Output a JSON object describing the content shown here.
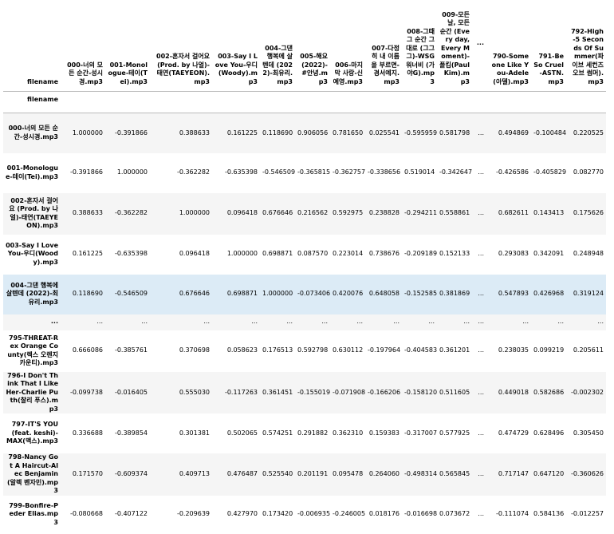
{
  "table": {
    "corner_label": "filename",
    "index_label": "filename",
    "columns": [
      "000-너의 모든 순간-성시경.mp3",
      "001-Monologue-테이(Tei).mp3",
      "002-혼자서 걸어요 (Prod. by 나얼)-태연(TAEYEON).mp3",
      "003-Say I Love You-우디(Woody).mp3",
      "004-그댄 행복에 살텐데 (2022)-최유리.mp3",
      "005-해요 (2022)-#안녕.mp3",
      "006-마지막 사랑-신예영.mp3",
      "007-다정히 내 이름을 부르면-경서예지.mp3",
      "008-그때 그 순간 그대로 (그그그)-WSG워너비 (가야G).mp3",
      "009-모든 날, 모든 순간 (Every day, Every Moment)-폴킴(Paul Kim).mp3",
      "...",
      "790-Someone Like You-Adele(아델).mp3",
      "791-Be So Cruel-ASTN.mp3",
      "792-High-5 Seconds Of Summer(파이브 세컨즈 오브 썸머).mp3"
    ],
    "rows": [
      {
        "label": "000-너의 모든 순간-성시경.mp3",
        "values": [
          "1.000000",
          "-0.391866",
          "0.388633",
          "0.161225",
          "0.118690",
          "0.906056",
          "0.781650",
          "0.025541",
          "-0.595959",
          "0.581798",
          "...",
          "0.494869",
          "-0.100484",
          "0.220525"
        ]
      },
      {
        "label": "001-Monologue-테이(Tei).mp3",
        "values": [
          "-0.391866",
          "1.000000",
          "-0.362282",
          "-0.635398",
          "-0.546509",
          "-0.365815",
          "-0.362757",
          "-0.338656",
          "0.519014",
          "-0.342647",
          "...",
          "-0.426586",
          "-0.405829",
          "0.082770"
        ]
      },
      {
        "label": "002-혼자서 걸어요 (Prod. by 나얼)-태연(TAEYEON).mp3",
        "values": [
          "0.388633",
          "-0.362282",
          "1.000000",
          "0.096418",
          "0.676646",
          "0.216562",
          "0.592975",
          "0.238828",
          "-0.294211",
          "0.558861",
          "...",
          "0.682611",
          "0.143413",
          "0.175626"
        ]
      },
      {
        "label": "003-Say I Love You-우디(Woody).mp3",
        "values": [
          "0.161225",
          "-0.635398",
          "0.096418",
          "1.000000",
          "0.698871",
          "0.087570",
          "0.223014",
          "0.738676",
          "-0.209189",
          "0.152133",
          "...",
          "0.293083",
          "0.342091",
          "0.248948"
        ]
      },
      {
        "label": "004-그댄 행복에 살텐데 (2022)-최유리.mp3",
        "values": [
          "0.118690",
          "-0.546509",
          "0.676646",
          "0.698871",
          "1.000000",
          "-0.073406",
          "0.420076",
          "0.648058",
          "-0.152585",
          "0.381869",
          "...",
          "0.547893",
          "0.426968",
          "0.319124"
        ]
      },
      {
        "label": "...",
        "values": [
          "...",
          "...",
          "...",
          "...",
          "...",
          "...",
          "...",
          "...",
          "...",
          "...",
          "...",
          "...",
          "...",
          "..."
        ]
      },
      {
        "label": "795-THREAT-Rex Orange County(렉스 오렌지 카운티).mp3",
        "values": [
          "0.666086",
          "-0.385761",
          "0.370698",
          "0.058623",
          "0.176513",
          "0.592798",
          "0.630112",
          "-0.197964",
          "-0.404583",
          "0.361201",
          "...",
          "0.238035",
          "0.099219",
          "0.205611"
        ]
      },
      {
        "label": "796-I Don't Think That I Like Her-Charlie Puth(찰리 푸스).mp3",
        "values": [
          "-0.099738",
          "-0.016405",
          "0.555030",
          "-0.117263",
          "0.361451",
          "-0.155019",
          "-0.071908",
          "-0.166206",
          "-0.158120",
          "0.511605",
          "...",
          "0.449018",
          "0.582686",
          "-0.002302"
        ]
      },
      {
        "label": "797-IT'S YOU (feat. keshi)-MAX(맥스).mp3",
        "values": [
          "0.336688",
          "-0.389854",
          "0.301381",
          "0.502065",
          "0.574251",
          "0.291882",
          "0.362310",
          "0.159383",
          "-0.317007",
          "0.577925",
          "...",
          "0.474729",
          "0.628496",
          "0.305450"
        ]
      },
      {
        "label": "798-Nancy Got A Haircut-Alec Benjamin(알렉 벤자민).mp3",
        "values": [
          "0.171570",
          "-0.609374",
          "0.409713",
          "0.476487",
          "0.525540",
          "0.201191",
          "0.095478",
          "0.264060",
          "-0.498314",
          "0.565845",
          "...",
          "0.717147",
          "0.647120",
          "-0.360626"
        ]
      },
      {
        "label": "799-Bonfire-Peder Elias.mp3",
        "values": [
          "-0.080668",
          "-0.407122",
          "-0.209639",
          "0.427970",
          "0.173420",
          "-0.006935",
          "-0.246005",
          "0.018176",
          "-0.016698",
          "0.073672",
          "...",
          "-0.111074",
          "0.584136",
          "-0.012257"
        ]
      }
    ]
  }
}
